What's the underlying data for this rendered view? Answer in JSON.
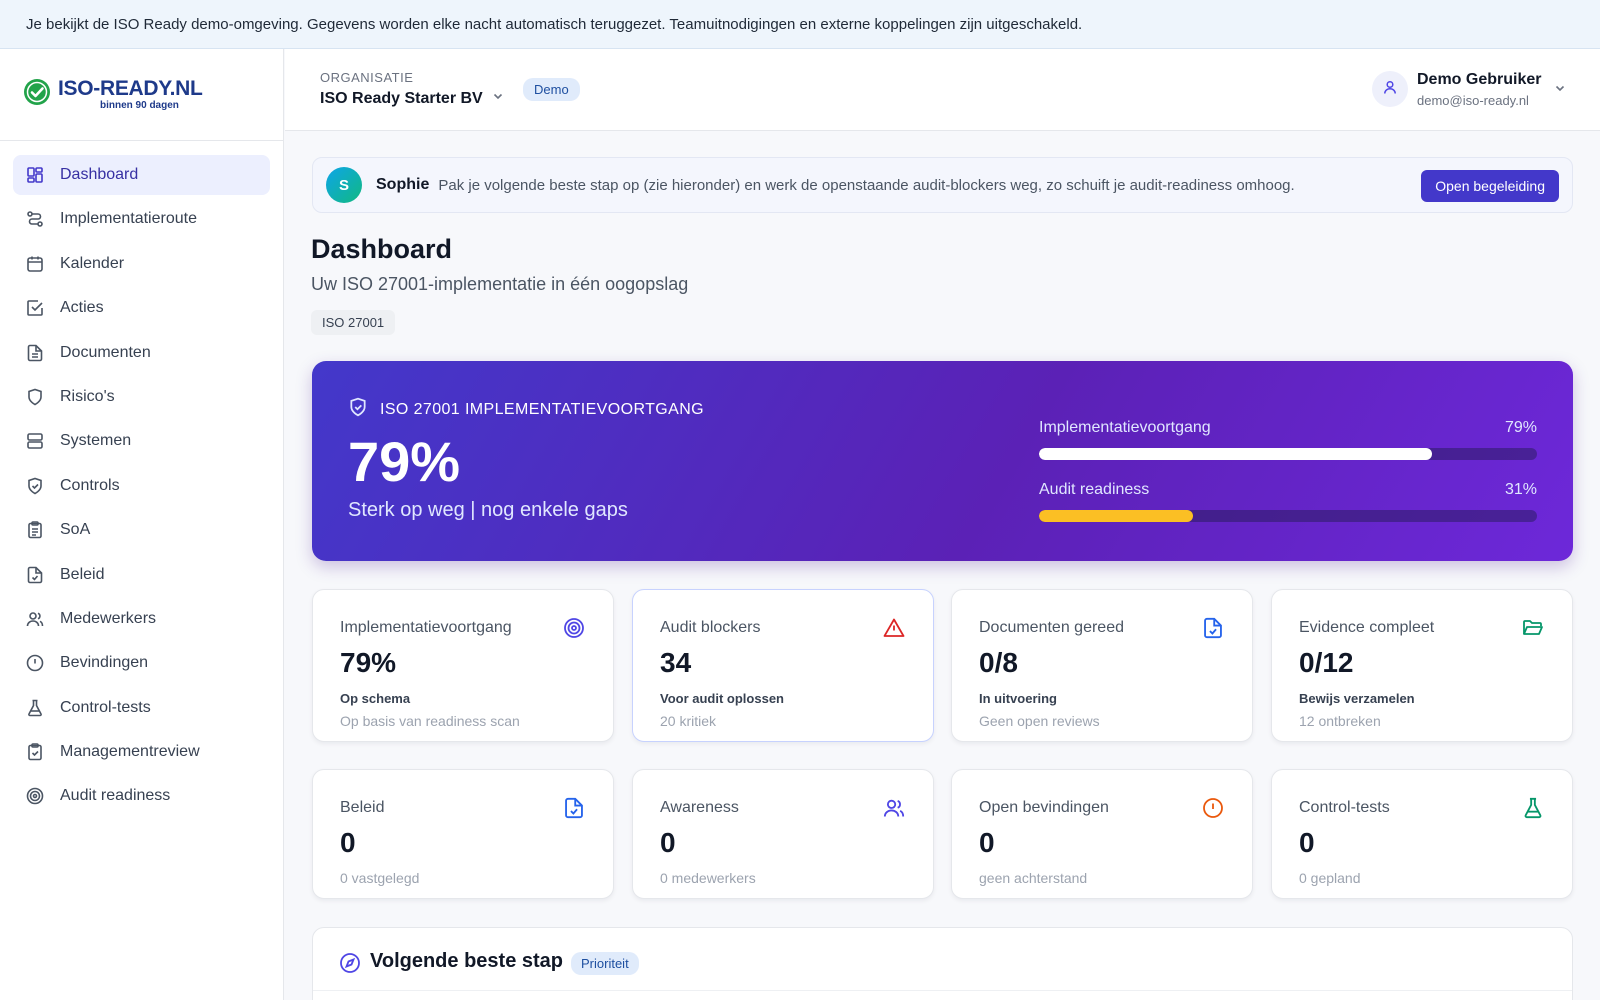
{
  "banner": {
    "text": "Je bekijkt de ISO Ready demo-omgeving. Gegevens worden elke nacht automatisch teruggezet. Teamuitnodigingen en externe koppelingen zijn uitgeschakeld."
  },
  "logo": {
    "main": "ISO-READY.NL",
    "sub": "binnen 90 dagen"
  },
  "sidebar": {
    "items": [
      {
        "label": "Dashboard",
        "icon": "dashboard-icon"
      },
      {
        "label": "Implementatieroute",
        "icon": "route-icon"
      },
      {
        "label": "Kalender",
        "icon": "calendar-icon"
      },
      {
        "label": "Acties",
        "icon": "checkbox-icon"
      },
      {
        "label": "Documenten",
        "icon": "document-icon"
      },
      {
        "label": "Risico's",
        "icon": "shield-icon"
      },
      {
        "label": "Systemen",
        "icon": "server-icon"
      },
      {
        "label": "Controls",
        "icon": "shield-check-icon"
      },
      {
        "label": "SoA",
        "icon": "clipboard-list-icon"
      },
      {
        "label": "Beleid",
        "icon": "file-check-icon"
      },
      {
        "label": "Medewerkers",
        "icon": "users-icon"
      },
      {
        "label": "Bevindingen",
        "icon": "alert-circle-icon"
      },
      {
        "label": "Control-tests",
        "icon": "flask-icon"
      },
      {
        "label": "Managementreview",
        "icon": "clipboard-check-icon"
      },
      {
        "label": "Audit readiness",
        "icon": "target-icon"
      }
    ]
  },
  "topbar": {
    "org_label": "ORGANISATIE",
    "org_name": "ISO Ready Starter BV",
    "badge": "Demo",
    "user_name": "Demo Gebruiker",
    "user_email": "demo@iso-ready.nl"
  },
  "assistant": {
    "initial": "S",
    "name": "Sophie",
    "message": "Pak je volgende beste stap op (zie hieronder) en werk de openstaande audit-blockers weg, zo schuift je audit-readiness omhoog.",
    "button": "Open begeleiding"
  },
  "page": {
    "title": "Dashboard",
    "subtitle": "Uw ISO 27001-implementatie in één oogopslag",
    "chip": "ISO 27001"
  },
  "hero": {
    "heading": "ISO 27001 IMPLEMENTATIEVOORTGANG",
    "percent": "79%",
    "subtitle": "Sterk op weg | nog enkele gaps",
    "bars": [
      {
        "label": "Implementatievoortgang",
        "value_text": "79%",
        "value": 79
      },
      {
        "label": "Audit readiness",
        "value_text": "31%",
        "value": 31
      }
    ]
  },
  "cards_row1": [
    {
      "title": "Implementatievoortgang",
      "value": "79%",
      "line1": "Op schema",
      "line2": "Op basis van readiness scan",
      "icon": "target-icon",
      "color": "#4f46e5"
    },
    {
      "title": "Audit blockers",
      "value": "34",
      "line1": "Voor audit oplossen",
      "line2": "20 kritiek",
      "icon": "alert-triangle-icon",
      "color": "#dc2626"
    },
    {
      "title": "Documenten gereed",
      "value": "0/8",
      "line1": "In uitvoering",
      "line2": "Geen open reviews",
      "icon": "file-check-icon",
      "color": "#2563eb"
    },
    {
      "title": "Evidence compleet",
      "value": "0/12",
      "line1": "Bewijs verzamelen",
      "line2": "12 ontbreken",
      "icon": "folder-open-icon",
      "color": "#059669"
    }
  ],
  "cards_row2": [
    {
      "title": "Beleid",
      "value": "0",
      "line2": "0 vastgelegd",
      "icon": "file-check-icon",
      "color": "#2563eb"
    },
    {
      "title": "Awareness",
      "value": "0",
      "line2": "0 medewerkers",
      "icon": "users-icon",
      "color": "#4f46e5"
    },
    {
      "title": "Open bevindingen",
      "value": "0",
      "line2": "geen achterstand",
      "icon": "alert-circle-icon",
      "color": "#ea580c"
    },
    {
      "title": "Control-tests",
      "value": "0",
      "line2": "0 gepland",
      "icon": "flask-icon",
      "color": "#059669"
    }
  ],
  "next_step": {
    "title": "Volgende beste stap",
    "badge": "Prioriteit"
  }
}
